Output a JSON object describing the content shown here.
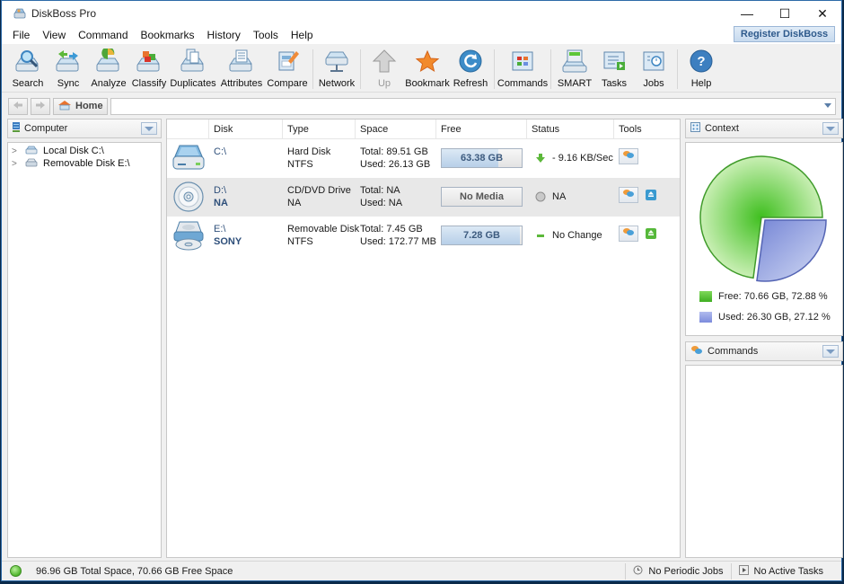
{
  "window": {
    "title": "DiskBoss Pro",
    "controls": {
      "minimize": "—",
      "maximize": "☐",
      "close": "✕"
    }
  },
  "menu": {
    "items": [
      "File",
      "View",
      "Command",
      "Bookmarks",
      "History",
      "Tools",
      "Help"
    ],
    "register_label": "Register DiskBoss"
  },
  "toolbar": {
    "buttons": [
      {
        "label": "Search",
        "icon": "search-icon"
      },
      {
        "label": "Sync",
        "icon": "sync-icon"
      },
      {
        "label": "Analyze",
        "icon": "analyze-icon"
      },
      {
        "label": "Classify",
        "icon": "classify-icon"
      },
      {
        "label": "Duplicates",
        "icon": "duplicates-icon"
      },
      {
        "label": "Attributes",
        "icon": "attributes-icon"
      },
      {
        "label": "Compare",
        "icon": "compare-icon"
      },
      {
        "label": "Network",
        "icon": "network-icon"
      },
      {
        "label": "Up",
        "icon": "up-arrow-icon",
        "disabled": true
      },
      {
        "label": "Bookmark",
        "icon": "star-icon"
      },
      {
        "label": "Refresh",
        "icon": "refresh-icon"
      },
      {
        "label": "Commands",
        "icon": "commands-icon"
      },
      {
        "label": "SMART",
        "icon": "smart-icon"
      },
      {
        "label": "Tasks",
        "icon": "tasks-icon"
      },
      {
        "label": "Jobs",
        "icon": "jobs-icon"
      },
      {
        "label": "Help",
        "icon": "help-icon"
      }
    ]
  },
  "nav": {
    "home_label": "Home",
    "address_value": ""
  },
  "left_panel": {
    "title": "Computer",
    "tree": [
      {
        "label": "Local Disk C:\\"
      },
      {
        "label": "Removable Disk E:\\"
      }
    ]
  },
  "table": {
    "columns": [
      "",
      "Disk",
      "Type",
      "Space",
      "Free",
      "Status",
      "Tools"
    ],
    "rows": [
      {
        "disk": "C:\\",
        "label": "",
        "type": "Hard Disk",
        "fs": "NTFS",
        "total": "Total: 89.51 GB",
        "used": "Used: 26.13 GB",
        "free": "63.38 GB",
        "free_fraction": 0.708,
        "status": "- 9.16 KB/Sec",
        "status_icon": "down-arrow-icon",
        "icon": "hard-disk-icon"
      },
      {
        "disk": "D:\\",
        "label": "NA",
        "type": "CD/DVD Drive",
        "fs": "NA",
        "total": "Total: NA",
        "used": "Used: NA",
        "free": "No Media",
        "free_fraction": 0,
        "status": "NA",
        "status_icon": "gray-circle-icon",
        "icon": "cd-drive-icon"
      },
      {
        "disk": "E:\\",
        "label": "SONY",
        "type": "Removable Disk",
        "fs": "NTFS",
        "total": "Total: 7.45 GB",
        "used": "Used: 172.77 MB",
        "free": "7.28 GB",
        "free_fraction": 0.977,
        "status": "No Change",
        "status_icon": "green-dash-icon",
        "icon": "removable-disk-icon"
      }
    ]
  },
  "context_panel": {
    "title": "Context",
    "legend": [
      {
        "label": "Free: 70.66 GB, 72.88 %",
        "color": "#5cc63a"
      },
      {
        "label": "Used: 26.30 GB, 27.12 %",
        "color": "#8e9be0"
      }
    ]
  },
  "commands_panel": {
    "title": "Commands"
  },
  "status_bar": {
    "summary": "96.96 GB Total Space, 70.66 GB Free Space",
    "periodic_jobs": "No Periodic Jobs",
    "active_tasks": "No Active Tasks"
  },
  "chart_data": {
    "type": "pie",
    "title": "",
    "slices": [
      {
        "name": "Free",
        "value": 70.66,
        "percent": 72.88,
        "color": "#5cc63a"
      },
      {
        "name": "Used",
        "value": 26.3,
        "percent": 27.12,
        "color": "#8e9be0"
      }
    ],
    "legend_position": "bottom"
  }
}
